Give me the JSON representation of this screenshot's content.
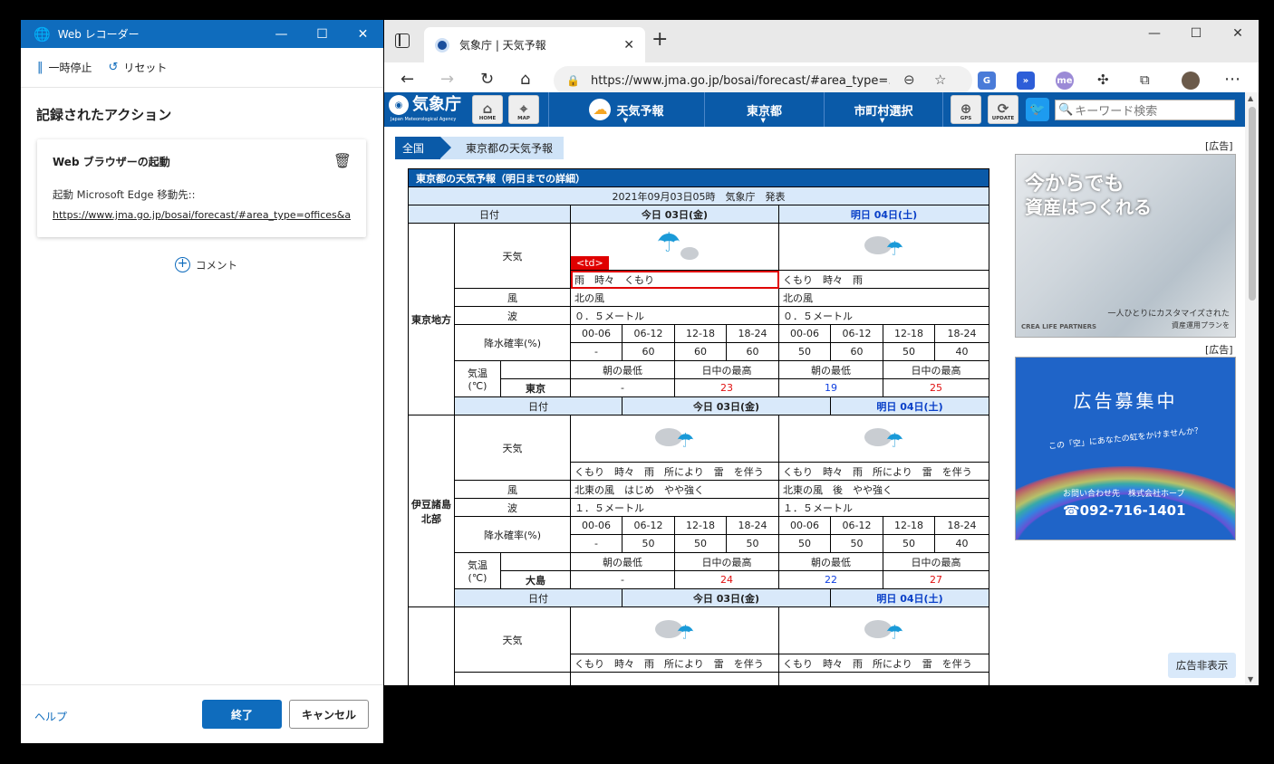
{
  "recorder": {
    "title": "Web レコーダー",
    "pause_label": "一時停止",
    "reset_label": "リセット",
    "heading": "記録されたアクション",
    "action": {
      "title": "Web ブラウザーの起動",
      "description": "起動 Microsoft Edge 移動先::",
      "url": "https://www.jma.go.jp/bosai/forecast/#area_type=offices&a..."
    },
    "comment_label": "コメント",
    "help_label": "ヘルプ",
    "finish_label": "終了",
    "cancel_label": "キャンセル"
  },
  "browser": {
    "tab_title": "気象庁 | 天気予報",
    "url": "https://www.jma.go.jp/bosai/forecast/#area_type=..."
  },
  "site": {
    "logo_name": "気象庁",
    "logo_en": "Japan Meteorological Agency",
    "home_label": "HOME",
    "map_label": "MAP",
    "menu_forecast": "天気予報",
    "menu_pref": "東京都",
    "menu_city": "市町村選択",
    "gps_label": "GPS",
    "update_label": "UPDATE",
    "search_placeholder": "キーワード検索",
    "breadcrumb_home": "全国",
    "breadcrumb_current": "東京都の天気予報"
  },
  "forecast": {
    "caption": "東京都の天気予報（明日までの詳細）",
    "published": "2021年09月03日05時　気象庁　発表",
    "labels": {
      "date": "日付",
      "weather": "天気",
      "wind": "風",
      "wave": "波",
      "pop": "降水確率(%)",
      "temp": "気温",
      "temp_unit": "(℃)",
      "morning_low": "朝の最低",
      "day_high": "日中の最高"
    },
    "today": "今日 03日(金)",
    "tomorrow": "明日 04日(土)",
    "periods": [
      "00-06",
      "06-12",
      "12-18",
      "18-24"
    ],
    "highlight_tag": "<td>",
    "regions": [
      {
        "name": "東京地方",
        "today_weather": "雨　時々　くもり",
        "tomorrow_weather": "くもり　時々　雨",
        "today_wind": "北の風",
        "tomorrow_wind": "北の風",
        "today_wave": "０．５メートル",
        "tomorrow_wave": "０．５メートル",
        "pop_today": [
          "-",
          "60",
          "60",
          "60"
        ],
        "pop_tomorrow": [
          "50",
          "60",
          "50",
          "40"
        ],
        "station": "東京",
        "today_low": "-",
        "today_high": "23",
        "tomorrow_low": "19",
        "tomorrow_high": "25"
      },
      {
        "name": "伊豆諸島北部",
        "today_weather": "くもり　時々　雨　所により　雷　を伴う",
        "tomorrow_weather": "くもり　時々　雨　所により　雷　を伴う",
        "today_wind": "北東の風　はじめ　やや強く",
        "tomorrow_wind": "北東の風　後　やや強く",
        "today_wave": "１．５メートル",
        "tomorrow_wave": "１．５メートル",
        "pop_today": [
          "-",
          "50",
          "50",
          "50"
        ],
        "pop_tomorrow": [
          "50",
          "50",
          "50",
          "40"
        ],
        "station": "大島",
        "today_low": "-",
        "today_high": "24",
        "tomorrow_low": "22",
        "tomorrow_high": "27"
      },
      {
        "today_weather": "くもり　時々　雨　所により　雷　を伴う",
        "tomorrow_weather": "くもり　時々　雨　所により　雷　を伴う"
      }
    ]
  },
  "ads": {
    "label": "[広告]",
    "ad1_line1": "今からでも",
    "ad1_line2": "資産はつくれる",
    "ad1_sub1": "一人ひとりにカスタマイズされた",
    "ad1_sub2": "資産運用プランを",
    "ad1_brand": "CREA LIFE PARTNERS",
    "ad2_title": "広告募集中",
    "ad2_tagline": "この「空」にあなたの虹をかけませんか？",
    "ad2_contact": "お問い合わせ先　株式会社ホープ",
    "ad2_phone": "☎092-716-1401",
    "hide_label": "広告非表示"
  },
  "colors": {
    "accent": "#0f6cbd",
    "jma_blue": "#0a5aa8",
    "header_light": "#d9e9fa",
    "high_temp": "#e01010",
    "low_temp": "#1040e0"
  }
}
